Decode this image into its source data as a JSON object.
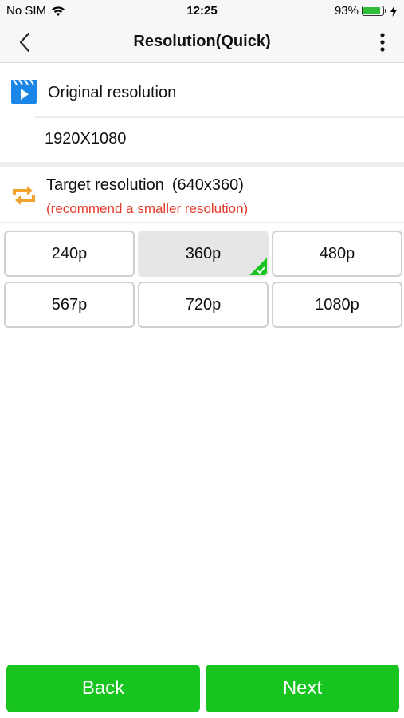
{
  "status_bar": {
    "carrier": "No SIM",
    "time": "12:25",
    "battery_percent": "93%",
    "battery_level": 0.93,
    "icons": [
      "wifi-icon",
      "battery-icon",
      "charging-bolt-icon"
    ]
  },
  "nav": {
    "title": "Resolution(Quick)",
    "back_icon": "chevron-left-icon",
    "more_icon": "vertical-dots-icon"
  },
  "original": {
    "label": "Original resolution",
    "value": "1920X1080",
    "icon": "video-clapper-icon"
  },
  "target": {
    "label": "Target resolution",
    "current": "(640x360)",
    "hint": "(recommend a smaller resolution)",
    "icon": "convert-arrows-icon"
  },
  "options": [
    {
      "label": "240p",
      "selected": false
    },
    {
      "label": "360p",
      "selected": true
    },
    {
      "label": "480p",
      "selected": false
    },
    {
      "label": "567p",
      "selected": false
    },
    {
      "label": "720p",
      "selected": false
    },
    {
      "label": "1080p",
      "selected": false
    }
  ],
  "buttons": {
    "back": "Back",
    "next": "Next"
  },
  "colors": {
    "accent_green": "#18c420",
    "hint_red": "#e53b2c",
    "video_icon_blue": "#1a86e8",
    "convert_icon_orange": "#f3a12f"
  }
}
